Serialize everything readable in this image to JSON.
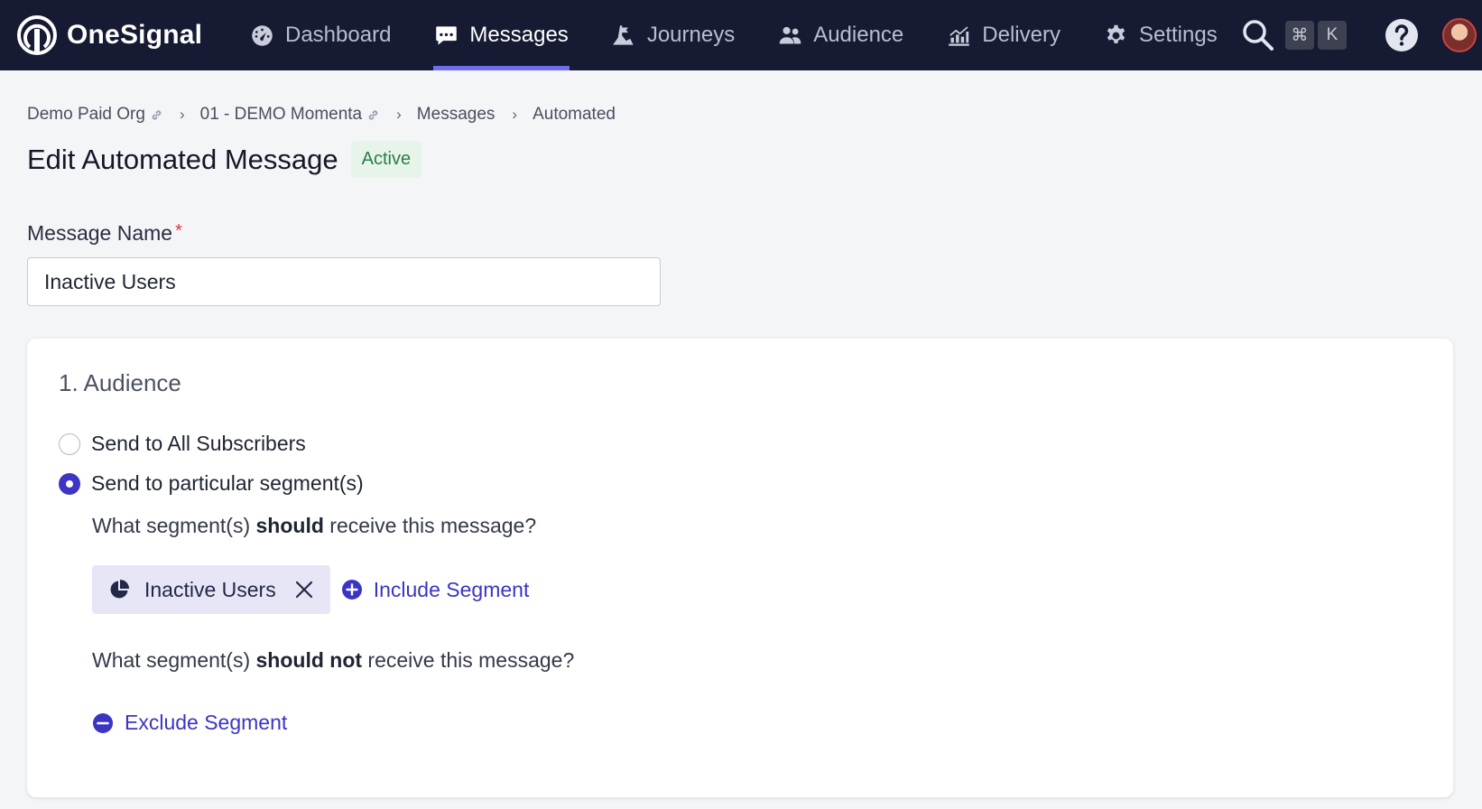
{
  "brand": {
    "name": "OneSignal"
  },
  "nav": {
    "items": [
      {
        "label": "Dashboard",
        "icon": "dashboard-icon",
        "active": false
      },
      {
        "label": "Messages",
        "icon": "messages-icon",
        "active": true
      },
      {
        "label": "Journeys",
        "icon": "journeys-icon",
        "active": false
      },
      {
        "label": "Audience",
        "icon": "audience-icon",
        "active": false
      },
      {
        "label": "Delivery",
        "icon": "delivery-icon",
        "active": false
      },
      {
        "label": "Settings",
        "icon": "gear-icon",
        "active": false
      }
    ],
    "shortcut_keys": [
      "⌘",
      "K"
    ]
  },
  "breadcrumb": [
    "Demo Paid Org",
    "01 - DEMO Momenta",
    "Messages",
    "Automated"
  ],
  "page": {
    "title": "Edit Automated Message",
    "status": "Active"
  },
  "form": {
    "name_label": "Message Name",
    "name_value": "Inactive Users"
  },
  "audience": {
    "section_title": "1. Audience",
    "option_all": "Send to All Subscribers",
    "option_segments": "Send to particular segment(s)",
    "selected_option": "segments",
    "include_question": {
      "prefix": "What segment(s) ",
      "emphasis": "should",
      "suffix": " receive this message?"
    },
    "included_segments": [
      "Inactive Users"
    ],
    "include_label": "Include Segment",
    "exclude_question": {
      "prefix": "What segment(s) ",
      "emphasis": "should not",
      "suffix": " receive this message?"
    },
    "exclude_label": "Exclude Segment"
  },
  "colors": {
    "nav_bg": "#161a33",
    "accent": "#3e35c6",
    "nav_underline": "#6e6df0",
    "status_green": "#2e7d45"
  }
}
